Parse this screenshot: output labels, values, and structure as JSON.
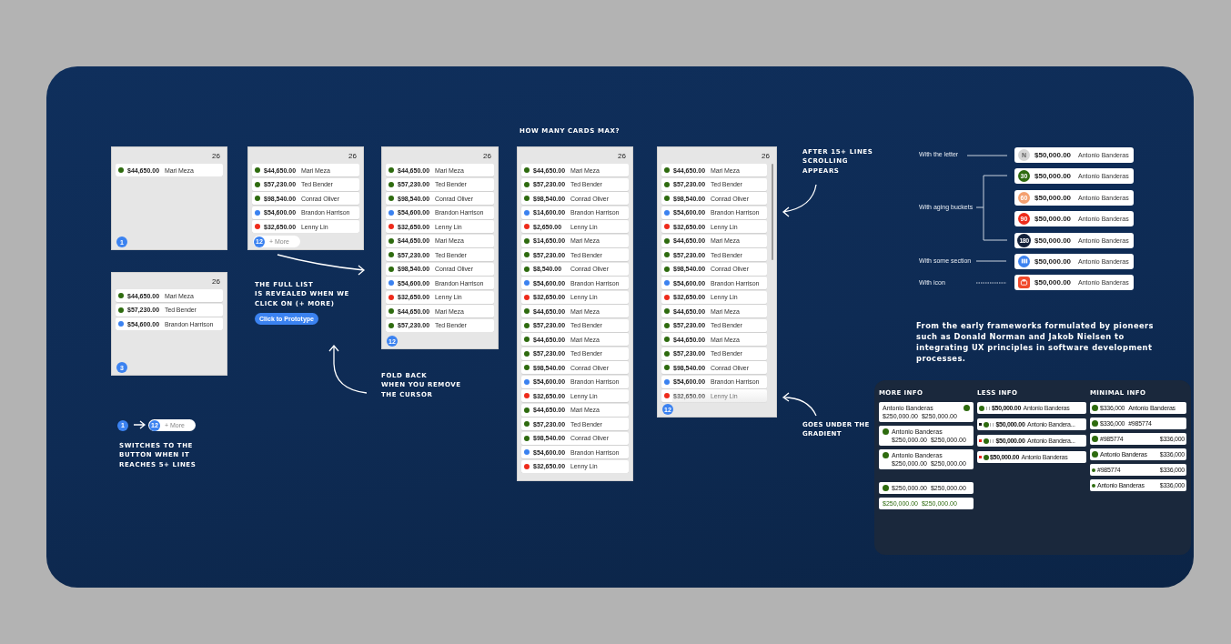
{
  "panels": [
    {
      "count": "26",
      "rows": [
        {
          "amount": "$44,650.00",
          "name": "Mari Meza",
          "color": "#2e6b0f"
        }
      ],
      "footer": {
        "kind": "badge",
        "badge": "1"
      }
    },
    {
      "count": "26",
      "rows": [
        {
          "amount": "$44,650.00",
          "name": "Mari Meza",
          "color": "#2e6b0f"
        },
        {
          "amount": "$57,230.00",
          "name": "Ted Bender",
          "color": "#2e6b0f"
        },
        {
          "amount": "$54,600.00",
          "name": "Brandon Harrison",
          "color": "#3b82f0"
        }
      ],
      "footer": {
        "kind": "badge",
        "badge": "3"
      }
    },
    {
      "count": "26",
      "rows": [
        {
          "amount": "$44,650.00",
          "name": "Mari Meza",
          "color": "#2e6b0f"
        },
        {
          "amount": "$57,230.00",
          "name": "Ted Bender",
          "color": "#2e6b0f"
        },
        {
          "amount": "$98,540.00",
          "name": "Conrad Oliver",
          "color": "#2e6b0f"
        },
        {
          "amount": "$54,600.00",
          "name": "Brandon Harrison",
          "color": "#3b82f0"
        },
        {
          "amount": "$32,650.00",
          "name": "Lenny Lin",
          "color": "#ee2b1b"
        }
      ],
      "footer": {
        "kind": "more",
        "badge": "12",
        "label": "+ More"
      }
    },
    {
      "count": "26",
      "rows": [
        {
          "amount": "$44,650.00",
          "name": "Mari Meza",
          "color": "#2e6b0f"
        },
        {
          "amount": "$57,230.00",
          "name": "Ted Bender",
          "color": "#2e6b0f"
        },
        {
          "amount": "$98,540.00",
          "name": "Conrad Oliver",
          "color": "#2e6b0f"
        },
        {
          "amount": "$54,600.00",
          "name": "Brandon Harrison",
          "color": "#3b82f0"
        },
        {
          "amount": "$32,650.00",
          "name": "Lenny Lin",
          "color": "#ee2b1b"
        },
        {
          "amount": "$44,650.00",
          "name": "Mari Meza",
          "color": "#2e6b0f"
        },
        {
          "amount": "$57,230.00",
          "name": "Ted Bender",
          "color": "#2e6b0f"
        },
        {
          "amount": "$98,540.00",
          "name": "Conrad Oliver",
          "color": "#2e6b0f"
        },
        {
          "amount": "$54,600.00",
          "name": "Brandon Harrison",
          "color": "#3b82f0"
        },
        {
          "amount": "$32,650.00",
          "name": "Lenny Lin",
          "color": "#ee2b1b"
        },
        {
          "amount": "$44,650.00",
          "name": "Mari Meza",
          "color": "#2e6b0f"
        },
        {
          "amount": "$57,230.00",
          "name": "Ted Bender",
          "color": "#2e6b0f"
        }
      ],
      "footer": {
        "kind": "badge",
        "badge": "12"
      }
    },
    {
      "count": "26",
      "rows": [
        {
          "amount": "$44,650.00",
          "name": "Mari Meza",
          "color": "#2e6b0f"
        },
        {
          "amount": "$57,230.00",
          "name": "Ted Bender",
          "color": "#2e6b0f"
        },
        {
          "amount": "$98,540.00",
          "name": "Conrad Oliver",
          "color": "#2e6b0f"
        },
        {
          "amount": "$14,600.00",
          "name": "Brandon Harrison",
          "color": "#3b82f0"
        },
        {
          "amount": "$2,650.00",
          "name": "Lenny Lin",
          "color": "#ee2b1b"
        },
        {
          "amount": "$14,650.00",
          "name": "Mari Meza",
          "color": "#2e6b0f"
        },
        {
          "amount": "$57,230.00",
          "name": "Ted Bender",
          "color": "#2e6b0f"
        },
        {
          "amount": "$8,540.00",
          "name": "Conrad Oliver",
          "color": "#2e6b0f"
        },
        {
          "amount": "$54,600.00",
          "name": "Brandon Harrison",
          "color": "#3b82f0"
        },
        {
          "amount": "$32,650.00",
          "name": "Lenny Lin",
          "color": "#ee2b1b"
        },
        {
          "amount": "$44,650.00",
          "name": "Mari Meza",
          "color": "#2e6b0f"
        },
        {
          "amount": "$57,230.00",
          "name": "Ted Bender",
          "color": "#2e6b0f"
        },
        {
          "amount": "$44,650.00",
          "name": "Mari Meza",
          "color": "#2e6b0f"
        },
        {
          "amount": "$57,230.00",
          "name": "Ted Bender",
          "color": "#2e6b0f"
        },
        {
          "amount": "$98,540.00",
          "name": "Conrad Oliver",
          "color": "#2e6b0f"
        },
        {
          "amount": "$54,600.00",
          "name": "Brandon Harrison",
          "color": "#3b82f0"
        },
        {
          "amount": "$32,650.00",
          "name": "Lenny Lin",
          "color": "#ee2b1b"
        },
        {
          "amount": "$44,650.00",
          "name": "Mari Meza",
          "color": "#2e6b0f"
        },
        {
          "amount": "$57,230.00",
          "name": "Ted Bender",
          "color": "#2e6b0f"
        },
        {
          "amount": "$98,540.00",
          "name": "Conrad Oliver",
          "color": "#2e6b0f"
        },
        {
          "amount": "$54,600.00",
          "name": "Brandon Harrison",
          "color": "#3b82f0"
        },
        {
          "amount": "$32,650.00",
          "name": "Lenny Lin",
          "color": "#ee2b1b"
        }
      ]
    },
    {
      "count": "26",
      "scrollbar": true,
      "gradient": true,
      "rows": [
        {
          "amount": "$44,650.00",
          "name": "Mari Meza",
          "color": "#2e6b0f"
        },
        {
          "amount": "$57,230.00",
          "name": "Ted Bender",
          "color": "#2e6b0f"
        },
        {
          "amount": "$98,540.00",
          "name": "Conrad Oliver",
          "color": "#2e6b0f"
        },
        {
          "amount": "$54,600.00",
          "name": "Brandon Harrison",
          "color": "#3b82f0"
        },
        {
          "amount": "$32,650.00",
          "name": "Lenny Lin",
          "color": "#ee2b1b"
        },
        {
          "amount": "$44,650.00",
          "name": "Mari Meza",
          "color": "#2e6b0f"
        },
        {
          "amount": "$57,230.00",
          "name": "Ted Bender",
          "color": "#2e6b0f"
        },
        {
          "amount": "$98,540.00",
          "name": "Conrad Oliver",
          "color": "#2e6b0f"
        },
        {
          "amount": "$54,600.00",
          "name": "Brandon Harrison",
          "color": "#3b82f0"
        },
        {
          "amount": "$32,650.00",
          "name": "Lenny Lin",
          "color": "#ee2b1b"
        },
        {
          "amount": "$44,650.00",
          "name": "Mari Meza",
          "color": "#2e6b0f"
        },
        {
          "amount": "$57,230.00",
          "name": "Ted Bender",
          "color": "#2e6b0f"
        },
        {
          "amount": "$44,650.00",
          "name": "Mari Meza",
          "color": "#2e6b0f"
        },
        {
          "amount": "$57,230.00",
          "name": "Ted Bender",
          "color": "#2e6b0f"
        },
        {
          "amount": "$98,540.00",
          "name": "Conrad Oliver",
          "color": "#2e6b0f"
        },
        {
          "amount": "$54,600.00",
          "name": "Brandon Harrison",
          "color": "#3b82f0"
        },
        {
          "amount": "$32,650.00",
          "name": "Lenny Lin",
          "color": "#ee2b1b"
        }
      ],
      "footer": {
        "kind": "badge",
        "badge": "12"
      }
    }
  ],
  "captions": [
    "HOW MANY CARDS MAX?",
    "THE FULL LIST\nIS REVEALED WHEN WE\nCLICK ON (+ MORE)",
    "FOLD BACK\nWHEN YOU REMOVE\nTHE CURSOR",
    "SWITCHES TO THE\nBUTTON WHEN IT\nREACHES 5+ LINES",
    "AFTER 15+ LINES\nSCROLLING\nAPPEARS",
    "GOES UNDER THE\nGRADIENT"
  ],
  "prototype_button": "Click to Prototype",
  "legend": {
    "from_badge": "1",
    "to_badge": "12",
    "more": "+ More"
  },
  "variants": {
    "labels": [
      "With the letter",
      "With aging buckets",
      "With some section",
      "With icon"
    ],
    "cards": [
      {
        "kind": "letter",
        "avatar": "N",
        "color": "#d6d6d6",
        "amount": "$50,000.00",
        "name": "Antonio Banderas"
      },
      {
        "kind": "bucket",
        "avatar": "30",
        "color": "#2e6b0f",
        "amount": "$50,000.00",
        "name": "Antonio Banderas"
      },
      {
        "kind": "bucket",
        "avatar": "60",
        "color": "#f4a070",
        "amount": "$50,000.00",
        "name": "Antonio Banderas"
      },
      {
        "kind": "bucket",
        "avatar": "90",
        "color": "#ee2b1b",
        "amount": "$50,000.00",
        "name": "Antonio Banderas"
      },
      {
        "kind": "bucket",
        "avatar": "180",
        "color": "#14213a",
        "amount": "$50,000.00",
        "name": "Antonio Banderas"
      },
      {
        "kind": "section",
        "color": "#3b82f0",
        "amount": "$50,000.00",
        "name": "Antonio Banderas"
      },
      {
        "kind": "icon",
        "color": "#f0482a",
        "amount": "$50,000.00",
        "name": "Antonio Banderas"
      }
    ]
  },
  "paragraph": "From the early frameworks formulated by pioneers such as Donald Norman and Jakob Nielsen to integrating UX principles in software development processes.",
  "info": {
    "more": {
      "title": "MORE INFO",
      "cards": [
        {
          "kind": "trailing",
          "name": "Antonio Banderas",
          "values": [
            "$250,000.00",
            "$250,000.00"
          ]
        },
        {
          "kind": "leading",
          "name": "Antonio Banderas",
          "values": [
            "$250,000.00",
            "$250,000.00"
          ]
        },
        {
          "kind": "leading",
          "name": "Antonio Banderas",
          "values": [
            "$250,000.00",
            "$250,000.00"
          ]
        },
        {
          "kind": "leading",
          "values": [
            "$250,000.00",
            "$250,000.00"
          ]
        },
        {
          "kind": "plain",
          "green": true,
          "values": [
            "$250,000.00",
            "$250,000.00"
          ]
        }
      ]
    },
    "less": {
      "title": "LESS INFO",
      "rows": [
        {
          "bars": true,
          "amount": "$50,000.00",
          "name": "Antonio Banderas"
        },
        {
          "color": "#1b1b1b",
          "bars": true,
          "amount": "$50,000.00",
          "name": "Antonio Bandera..."
        },
        {
          "color": "#e8231a",
          "bars": true,
          "amount": "$50,000.00",
          "name": "Antonio Bandera..."
        },
        {
          "color": "#e8231a",
          "bars": false,
          "amount": "$50,000.00",
          "name": "Antonio Banderas"
        }
      ]
    },
    "minimal": {
      "title": "MINIMAL INFO",
      "rows": [
        {
          "kind": "avatar",
          "left": "$336,000",
          "right": "Antonio Banderas",
          "adjacent": true
        },
        {
          "kind": "avatar",
          "left": "$336,000",
          "right": "#985774",
          "adjacent": true
        },
        {
          "kind": "avatar",
          "left": "#985774",
          "right": "$336,000",
          "adjacent": false
        },
        {
          "kind": "avatar",
          "left": "Antonio Banderas",
          "right": "$336,000",
          "adjacent": false
        },
        {
          "kind": "dot",
          "left": "#985774",
          "right": "$336,000",
          "adjacent": false
        },
        {
          "kind": "dot",
          "left": "Antonio Banderas",
          "right": "$336,000",
          "adjacent": false
        }
      ]
    }
  }
}
